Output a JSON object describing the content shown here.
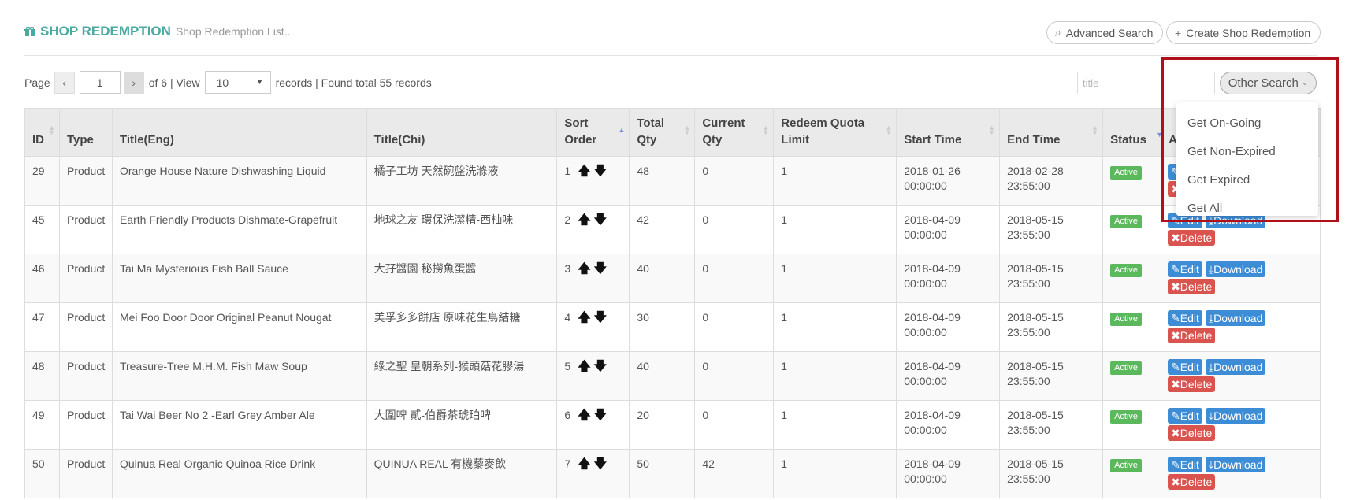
{
  "header": {
    "title": "SHOP REDEMPTION",
    "subtitle": "Shop Redemption List...",
    "advanced_search": "Advanced Search",
    "create": "Create Shop Redemption"
  },
  "pager": {
    "page_label": "Page",
    "prev": "‹",
    "page_value": "1",
    "next": "›",
    "of_text": "of 6 | View",
    "per_page": "10",
    "records_text": "records | Found total 55 records"
  },
  "search": {
    "placeholder": "title",
    "other_search": "Other Search"
  },
  "dropdown": {
    "items": [
      "Get On-Going",
      "Get Non-Expired",
      "Get Expired",
      "Get All"
    ]
  },
  "columns": [
    {
      "label": "ID"
    },
    {
      "label": "Type"
    },
    {
      "label": "Title(Eng)"
    },
    {
      "label": "Title(Chi)"
    },
    {
      "label": "Sort Order"
    },
    {
      "label": "Total Qty"
    },
    {
      "label": "Current Qty"
    },
    {
      "label": "Redeem Quota Limit"
    },
    {
      "label": "Start Time"
    },
    {
      "label": "End Time"
    },
    {
      "label": "Status"
    },
    {
      "label": "A"
    }
  ],
  "actions": {
    "edit": "✎Edit",
    "download": "⤓Download",
    "delete": "✖Delete"
  },
  "rows": [
    {
      "id": "29",
      "type": "Product",
      "eng": "Orange House Nature Dishwashing Liquid",
      "chi": "橘子工坊 天然碗盤洗滌液",
      "sort": "1",
      "total": "48",
      "current": "0",
      "quota": "1",
      "start": "2018-01-26",
      "start_t": "00:00:00",
      "end": "2018-02-28",
      "end_t": "23:55:00",
      "status": "Active"
    },
    {
      "id": "45",
      "type": "Product",
      "eng": "Earth Friendly Products Dishmate-Grapefruit",
      "chi": "地球之友 環保洗潔精-西柚味",
      "sort": "2",
      "total": "42",
      "current": "0",
      "quota": "1",
      "start": "2018-04-09",
      "start_t": "00:00:00",
      "end": "2018-05-15",
      "end_t": "23:55:00",
      "status": "Active"
    },
    {
      "id": "46",
      "type": "Product",
      "eng": "Tai Ma Mysterious Fish Ball Sauce",
      "chi": "大孖醬園 秘撈魚蛋醬",
      "sort": "3",
      "total": "40",
      "current": "0",
      "quota": "1",
      "start": "2018-04-09",
      "start_t": "00:00:00",
      "end": "2018-05-15",
      "end_t": "23:55:00",
      "status": "Active"
    },
    {
      "id": "47",
      "type": "Product",
      "eng": "Mei Foo Door Door Original Peanut Nougat",
      "chi": "美孚多多餅店 原味花生鳥結糖",
      "sort": "4",
      "total": "30",
      "current": "0",
      "quota": "1",
      "start": "2018-04-09",
      "start_t": "00:00:00",
      "end": "2018-05-15",
      "end_t": "23:55:00",
      "status": "Active"
    },
    {
      "id": "48",
      "type": "Product",
      "eng": "Treasure-Tree M.H.M. Fish Maw Soup",
      "chi": "綠之聖 皇朝系列-猴頭菇花膠湯",
      "sort": "5",
      "total": "40",
      "current": "0",
      "quota": "1",
      "start": "2018-04-09",
      "start_t": "00:00:00",
      "end": "2018-05-15",
      "end_t": "23:55:00",
      "status": "Active"
    },
    {
      "id": "49",
      "type": "Product",
      "eng": "Tai Wai Beer No 2 -Earl Grey Amber Ale",
      "chi": "大圍啤 貳-伯爵茶琥珀啤",
      "sort": "6",
      "total": "20",
      "current": "0",
      "quota": "1",
      "start": "2018-04-09",
      "start_t": "00:00:00",
      "end": "2018-05-15",
      "end_t": "23:55:00",
      "status": "Active"
    },
    {
      "id": "50",
      "type": "Product",
      "eng": "Quinua Real Organic Quinoa Rice Drink",
      "chi": "QUINUA REAL 有機藜麥飲",
      "sort": "7",
      "total": "50",
      "current": "42",
      "quota": "1",
      "start": "2018-04-09",
      "start_t": "00:00:00",
      "end": "2018-05-15",
      "end_t": "23:55:00",
      "status": "Active"
    }
  ]
}
